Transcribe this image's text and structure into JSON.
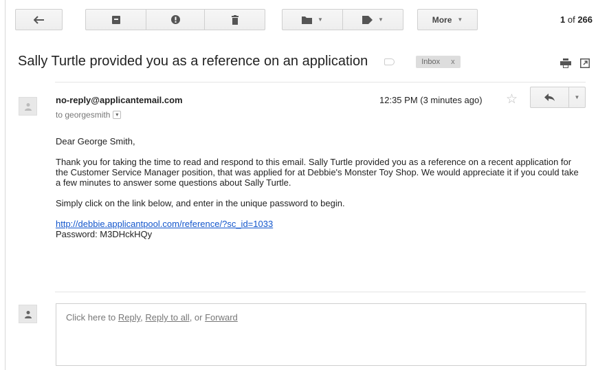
{
  "toolbar": {
    "back_icon": "back-arrow-icon",
    "archive_icon": "archive-icon",
    "spam_icon": "report-spam-icon",
    "delete_icon": "trash-icon",
    "move_icon": "folder-icon",
    "labels_icon": "label-tag-icon",
    "more_label": "More",
    "pager_current": "1",
    "pager_of": "of",
    "pager_total": "266"
  },
  "email": {
    "subject": "Sally Turtle provided you as a reference on an application",
    "label_chip": "Inbox",
    "label_chip_close": "x",
    "sender": "no-reply@applicantemail.com",
    "to_line": "to georgesmith",
    "timestamp": "12:35 PM (3 minutes ago)",
    "greeting": "Dear George Smith,",
    "paragraph1": "Thank you for taking the time to read and respond to this email. Sally Turtle provided you as a reference on a recent application for the Customer Service Manager position, that was applied for at Debbie's Monster Toy Shop. We would appreciate it if you could take a few minutes to answer some questions about Sally Turtle.",
    "paragraph2": "Simply click on the link below, and enter in the unique password to begin.",
    "link": "http://debbie.applicantpool.com/reference/?sc_id=1033",
    "password_line": "Password: M3DHckHQy"
  },
  "reply": {
    "prefix": "Click here to ",
    "reply": "Reply",
    "sep1": ", ",
    "reply_all": "Reply to all",
    "sep2": ", or ",
    "forward": "Forward"
  },
  "colors": {
    "link": "#1155cc",
    "chip_bg": "#dddddd",
    "button_bg": "#f1f1f1"
  }
}
